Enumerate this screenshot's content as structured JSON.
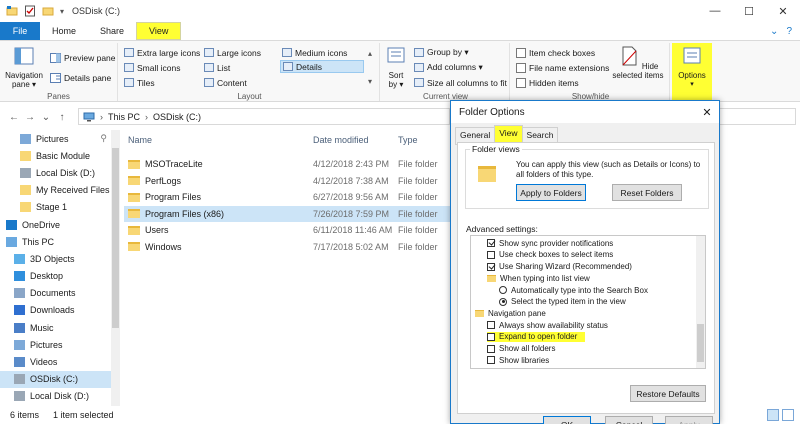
{
  "window": {
    "title": "OSDisk (C:)"
  },
  "ribbon_tabs": [
    {
      "label": "File"
    },
    {
      "label": "Home"
    },
    {
      "label": "Share"
    },
    {
      "label": "View"
    }
  ],
  "ribbon": {
    "panes": {
      "label": "Panes",
      "navigation_pane": "Navigation pane ▾",
      "preview_pane": "Preview pane",
      "details_pane": "Details pane"
    },
    "layout": {
      "label": "Layout",
      "items": [
        {
          "label": "Extra large icons"
        },
        {
          "label": "Large icons"
        },
        {
          "label": "Medium icons"
        },
        {
          "label": "Small icons"
        },
        {
          "label": "List"
        },
        {
          "label": "Details"
        },
        {
          "label": "Tiles"
        },
        {
          "label": "Content"
        }
      ],
      "selected": "Details"
    },
    "current_view": {
      "label": "Current view",
      "sort_by": "Sort by ▾",
      "group_by": "Group by ▾",
      "add_columns": "Add columns ▾",
      "size_columns": "Size all columns to fit"
    },
    "show_hide": {
      "label": "Show/hide",
      "item_check_boxes": "Item check boxes",
      "file_name_extensions": "File name extensions",
      "hidden_items": "Hidden items",
      "hide_selected": "Hide selected items",
      "options": "Options"
    }
  },
  "address": {
    "crumbs": [
      "This PC",
      "OSDisk (C:)"
    ]
  },
  "nav_pane": [
    {
      "label": "Pictures",
      "icon": "pictures-icon"
    },
    {
      "label": "Basic Module",
      "icon": "folder-icon"
    },
    {
      "label": "Local Disk (D:)",
      "icon": "drive-icon"
    },
    {
      "label": "My Received Files",
      "icon": "folder-icon"
    },
    {
      "label": "Stage 1",
      "icon": "folder-icon"
    },
    {
      "label": "OneDrive",
      "icon": "onedrive-icon"
    },
    {
      "label": "This PC",
      "icon": "computer-icon"
    },
    {
      "label": "3D Objects",
      "icon": "3d-objects-icon"
    },
    {
      "label": "Desktop",
      "icon": "desktop-icon"
    },
    {
      "label": "Documents",
      "icon": "documents-icon"
    },
    {
      "label": "Downloads",
      "icon": "downloads-icon"
    },
    {
      "label": "Music",
      "icon": "music-icon"
    },
    {
      "label": "Pictures",
      "icon": "pictures-icon"
    },
    {
      "label": "Videos",
      "icon": "videos-icon"
    },
    {
      "label": "OSDisk (C:)",
      "icon": "drive-icon"
    },
    {
      "label": "Local Disk (D:)",
      "icon": "drive-icon"
    }
  ],
  "files": {
    "columns": {
      "name": "Name",
      "date": "Date modified",
      "type": "Type"
    },
    "rows": [
      {
        "name": "MSOTraceLite",
        "date": "4/12/2018 2:43 PM",
        "type": "File folder"
      },
      {
        "name": "PerfLogs",
        "date": "4/12/2018 7:38 AM",
        "type": "File folder"
      },
      {
        "name": "Program Files",
        "date": "6/27/2018 9:56 AM",
        "type": "File folder"
      },
      {
        "name": "Program Files (x86)",
        "date": "7/26/2018 7:59 PM",
        "type": "File folder"
      },
      {
        "name": "Users",
        "date": "6/11/2018 11:46 AM",
        "type": "File folder"
      },
      {
        "name": "Windows",
        "date": "7/17/2018 5:02 AM",
        "type": "File folder"
      }
    ]
  },
  "status": {
    "count": "6 items",
    "selected": "1 item selected"
  },
  "dialog": {
    "title": "Folder Options",
    "tabs": [
      "General",
      "View",
      "Search"
    ],
    "folder_views": {
      "legend": "Folder views",
      "text": "You can apply this view (such as Details or Icons) to all folders of this type.",
      "apply_button": "Apply to Folders",
      "reset_button": "Reset Folders"
    },
    "advanced_label": "Advanced settings:",
    "advanced_items": [
      {
        "label": "Show sync provider notifications",
        "kind": "checkbox",
        "checked": true
      },
      {
        "label": "Use check boxes to select items",
        "kind": "checkbox",
        "checked": false
      },
      {
        "label": "Use Sharing Wizard (Recommended)",
        "kind": "checkbox",
        "checked": true
      },
      {
        "label": "When typing into list view",
        "kind": "folder"
      },
      {
        "label": "Automatically type into the Search Box",
        "kind": "radio",
        "checked": false
      },
      {
        "label": "Select the typed item in the view",
        "kind": "radio",
        "checked": true
      },
      {
        "label": "Navigation pane",
        "kind": "folder"
      },
      {
        "label": "Always show availability status",
        "kind": "checkbox",
        "checked": false
      },
      {
        "label": "Expand to open folder",
        "kind": "checkbox",
        "checked": false,
        "highlight": true
      },
      {
        "label": "Show all folders",
        "kind": "checkbox",
        "checked": false
      },
      {
        "label": "Show libraries",
        "kind": "checkbox",
        "checked": false
      }
    ],
    "restore_button": "Restore Defaults",
    "ok_button": "OK",
    "cancel_button": "Cancel",
    "apply_button": "Apply"
  },
  "colors": {
    "accent": "#1979ca",
    "highlight": "#ffff33",
    "selection": "#cce4f7"
  }
}
